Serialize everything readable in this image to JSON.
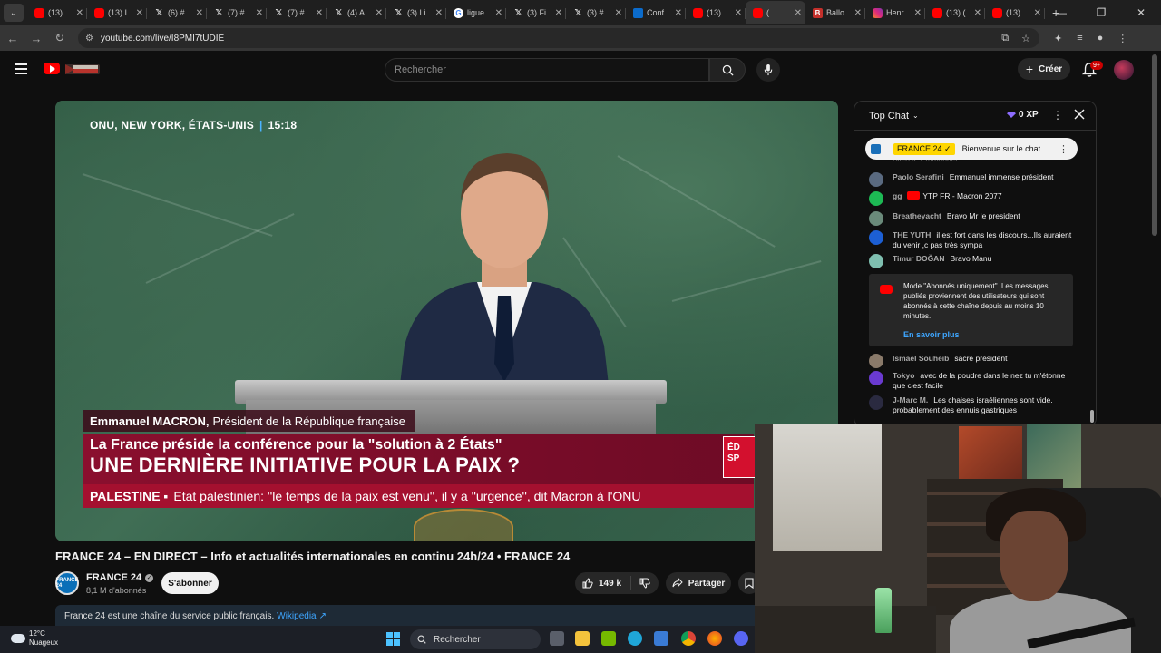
{
  "browser": {
    "tabs": [
      {
        "favicon": "youtube-icon",
        "title": "(13) ",
        "active": false
      },
      {
        "favicon": "youtube-icon",
        "title": "(13) I",
        "active": false
      },
      {
        "favicon": "x-icon",
        "title": "(6) #",
        "active": false
      },
      {
        "favicon": "x-icon",
        "title": "(7) #",
        "active": false
      },
      {
        "favicon": "x-icon",
        "title": "(7) #",
        "active": false
      },
      {
        "favicon": "x-icon",
        "title": "(4) A",
        "active": false
      },
      {
        "favicon": "x-icon",
        "title": "(3) Li",
        "active": false
      },
      {
        "favicon": "google-icon",
        "title": "ligue",
        "active": false
      },
      {
        "favicon": "x-icon",
        "title": "(3) Fi",
        "active": false
      },
      {
        "favicon": "x-icon",
        "title": "(3) #",
        "active": false
      },
      {
        "favicon": "site-icon",
        "title": "Conf",
        "active": false
      },
      {
        "favicon": "youtube-icon",
        "title": "(13)",
        "active": false
      },
      {
        "favicon": "youtube-icon",
        "title": "(",
        "active": true
      },
      {
        "favicon": "bandcamp-icon",
        "title": "Ballo",
        "active": false
      },
      {
        "favicon": "instagram-icon",
        "title": "Henr",
        "active": false
      },
      {
        "favicon": "youtube-icon",
        "title": "(13) (",
        "active": false
      },
      {
        "favicon": "youtube-icon",
        "title": "(13)",
        "active": false
      }
    ],
    "url": "youtube.com/live/I8PMI7tUDIE"
  },
  "youtube": {
    "search_placeholder": "Rechercher",
    "create_label": "Créer",
    "notifications_badge": "9+"
  },
  "video": {
    "location_label": "ONU, NEW YORK, ÉTATS-UNIS",
    "time_label": "15:18",
    "speaker_name": "Emmanuel MACRON,",
    "speaker_role": "Président de la République française",
    "headline_sub": "La France préside la conférence pour la \"solution à 2 États\"",
    "headline_main": "UNE DERNIÈRE INITIATIVE POUR LA PAIX ?",
    "ticker_tag": "PALESTINE ▪",
    "ticker_text": "Etat palestinien: ''le temps de la paix est venu'', il y a ''urgence'', dit Macron à l'ONU",
    "side_badge": "ÉD SP",
    "title": "FRANCE 24 – EN DIRECT – Info et actualités internationales en continu 24h/24 • FRANCE 24"
  },
  "channel": {
    "name": "FRANCE 24",
    "avatar_text": "FRANCE 24",
    "subscribers": "8,1 M d'abonnés",
    "subscribe_label": "S'abonner",
    "likes": "149 k",
    "share_label": "Partager",
    "info_text": "France 24 est une chaîne du service public français.",
    "info_link": "Wikipedia"
  },
  "chat": {
    "mode_label": "Top Chat",
    "xp_label": "0 XP",
    "pinned_badge": "FRANCE 24 ✓",
    "pinned_text": "Bienvenue sur le chat...",
    "partial_top": "BilerDZ  Emmanuel...",
    "messages": [
      {
        "author": "Paolo Serafini",
        "text": "Emmanuel immense président",
        "color": "#5a6a80"
      },
      {
        "author": "gg",
        "text": "YTP FR - Macron 2077",
        "color": "#1db954",
        "badge": true
      },
      {
        "author": "Breatheyacht",
        "text": "Bravo Mr le president",
        "color": "#6a8a7a"
      },
      {
        "author": "THE YUTH",
        "text": "il est fort dans les discours...Ils auraient du venir ,c pas très sympa",
        "color": "#1c5fd4"
      },
      {
        "author": "Timur DOĞAN",
        "text": "Bravo Manu",
        "color": "#7fbfb0"
      }
    ],
    "notice_text": "Mode \"Abonnés uniquement\". Les messages publiés proviennent des utilisateurs qui sont abonnés à cette chaîne depuis au moins 10 minutes.",
    "notice_link": "En savoir plus",
    "messages_after": [
      {
        "author": "Ismael Souheib",
        "text": "sacré président",
        "color": "#8a7a6a"
      },
      {
        "author": "Tokyo",
        "text": "avec de la poudre dans le nez tu m'étonne que c'est facile",
        "color": "#6a3ad0"
      },
      {
        "author": "J-Marc M.",
        "text": "Les chaises israéliennes sont vide. probablement des ennuis gastriques",
        "color": "#2a2a40"
      }
    ]
  },
  "taskbar": {
    "temperature": "12°C",
    "weather": "Nuageux",
    "search_label": "Rechercher"
  }
}
